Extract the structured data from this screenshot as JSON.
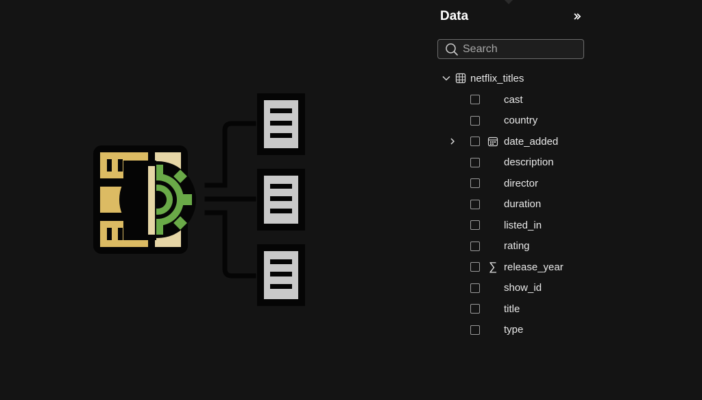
{
  "pane": {
    "title": "Data",
    "search": {
      "placeholder": "Search",
      "value": ""
    },
    "table": {
      "name": "netflix_titles",
      "expanded": true
    },
    "fields": [
      {
        "label": "cast",
        "type_icon": "",
        "expandable": false
      },
      {
        "label": "country",
        "type_icon": "",
        "expandable": false
      },
      {
        "label": "date_added",
        "type_icon": "calendar-icon",
        "expandable": true
      },
      {
        "label": "description",
        "type_icon": "",
        "expandable": false
      },
      {
        "label": "director",
        "type_icon": "",
        "expandable": false
      },
      {
        "label": "duration",
        "type_icon": "",
        "expandable": false
      },
      {
        "label": "listed_in",
        "type_icon": "",
        "expandable": false
      },
      {
        "label": "rating",
        "type_icon": "",
        "expandable": false
      },
      {
        "label": "release_year",
        "type_icon": "sigma-icon",
        "expandable": false
      },
      {
        "label": "show_id",
        "type_icon": "",
        "expandable": false
      },
      {
        "label": "title",
        "type_icon": "",
        "expandable": false
      },
      {
        "label": "type",
        "type_icon": "",
        "expandable": false
      }
    ]
  },
  "colors": {
    "background": "#141414",
    "text": "#e8e8e8",
    "server_gold": "#dcbb63",
    "server_cream": "#e6d6a6",
    "gear_green": "#6aaa48",
    "document_gray": "#c9c9c9"
  },
  "illustration": {
    "icon": "database-server-with-gear-and-documents-icon"
  }
}
